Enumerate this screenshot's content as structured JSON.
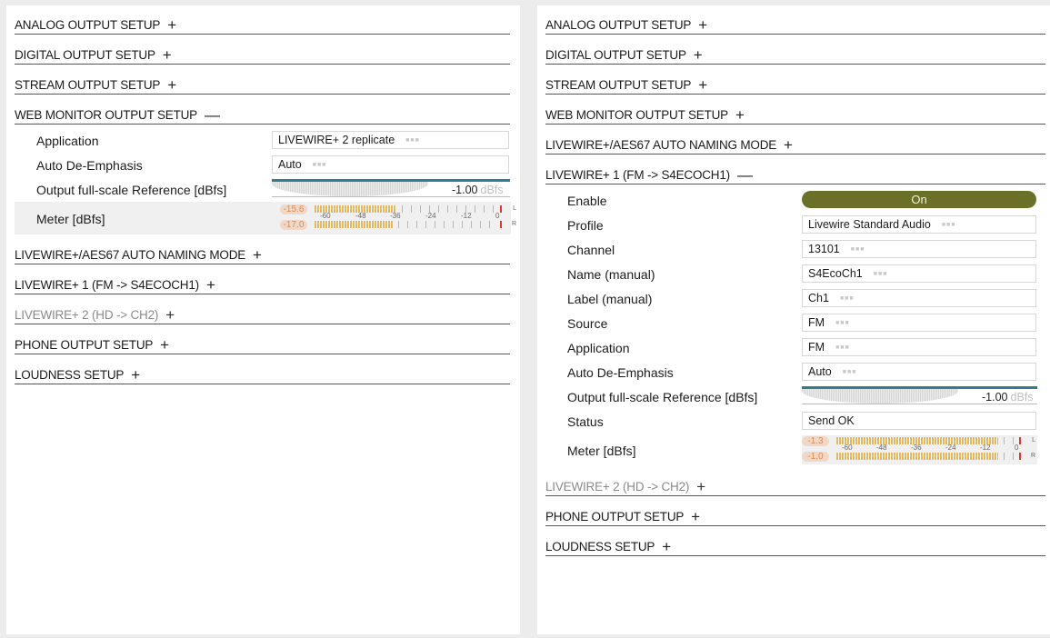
{
  "left": {
    "sections_before": [
      {
        "title": "ANALOG OUTPUT SETUP",
        "toggle": "+"
      },
      {
        "title": "DIGITAL OUTPUT SETUP",
        "toggle": "+"
      },
      {
        "title": "STREAM OUTPUT SETUP",
        "toggle": "+"
      }
    ],
    "open_section": {
      "title": "WEB MONITOR OUTPUT SETUP",
      "toggle": "—",
      "application_label": "Application",
      "application_value": "LIVEWIRE+ 2 replicate",
      "deemph_label": "Auto De-Emphasis",
      "deemph_value": "Auto",
      "reference_label": "Output full-scale Reference [dBfs]",
      "reference_value": "-1.00",
      "reference_unit": "dBfs",
      "meter_label": "Meter [dBfs]",
      "meter_left_value": "-15.6",
      "meter_right_value": "-17.0",
      "meter_left_level": 0.43,
      "meter_right_level": 0.41
    },
    "sections_after": [
      {
        "title": "LIVEWIRE+/AES67 AUTO NAMING MODE",
        "toggle": "+"
      },
      {
        "title": "LIVEWIRE+ 1 (FM -> S4ECOCH1)",
        "toggle": "+"
      },
      {
        "title": "LIVEWIRE+ 2 (HD -> CH2)",
        "toggle": "+"
      },
      {
        "title": "PHONE OUTPUT SETUP",
        "toggle": "+"
      },
      {
        "title": "LOUDNESS SETUP",
        "toggle": "+"
      }
    ]
  },
  "right": {
    "sections_before": [
      {
        "title": "ANALOG OUTPUT SETUP",
        "toggle": "+"
      },
      {
        "title": "DIGITAL OUTPUT SETUP",
        "toggle": "+"
      },
      {
        "title": "STREAM OUTPUT SETUP",
        "toggle": "+"
      },
      {
        "title": "WEB MONITOR OUTPUT SETUP",
        "toggle": "+"
      },
      {
        "title": "LIVEWIRE+/AES67 AUTO NAMING MODE",
        "toggle": "+"
      }
    ],
    "open_section": {
      "title": "LIVEWIRE+ 1 (FM -> S4ECOCH1)",
      "toggle": "—",
      "enable_label": "Enable",
      "enable_value": "On",
      "profile_label": "Profile",
      "profile_value": "Livewire Standard Audio",
      "channel_label": "Channel",
      "channel_value": "13101",
      "name_label": "Name (manual)",
      "name_value": "S4EcoCh1",
      "label_label": "Label (manual)",
      "label_value": "Ch1",
      "source_label": "Source",
      "source_value": "FM",
      "application_label": "Application",
      "application_value": "FM",
      "deemph_label": "Auto De-Emphasis",
      "deemph_value": "Auto",
      "reference_label": "Output full-scale Reference [dBfs]",
      "reference_value": "-1.00",
      "reference_unit": "dBfs",
      "status_label": "Status",
      "status_value": "Send OK",
      "meter_label": "Meter [dBfs]",
      "meter_left_value": "-1.3",
      "meter_right_value": "-1.0",
      "meter_left_level": 0.86,
      "meter_right_level": 0.86
    },
    "sections_after": [
      {
        "title": "LIVEWIRE+ 2 (HD -> CH2)",
        "toggle": "+"
      },
      {
        "title": "PHONE OUTPUT SETUP",
        "toggle": "+"
      },
      {
        "title": "LOUDNESS SETUP",
        "toggle": "+"
      }
    ]
  },
  "meter_scale": [
    "-60",
    "-48",
    "-36",
    "-24",
    "-12",
    "0"
  ],
  "channel_labels": {
    "left": "L",
    "right": "R"
  },
  "colors": {
    "accent": "#2f7f8a",
    "switch_on": "#6b7028",
    "meter": "#e6b864",
    "peak": "#d83a2e"
  }
}
